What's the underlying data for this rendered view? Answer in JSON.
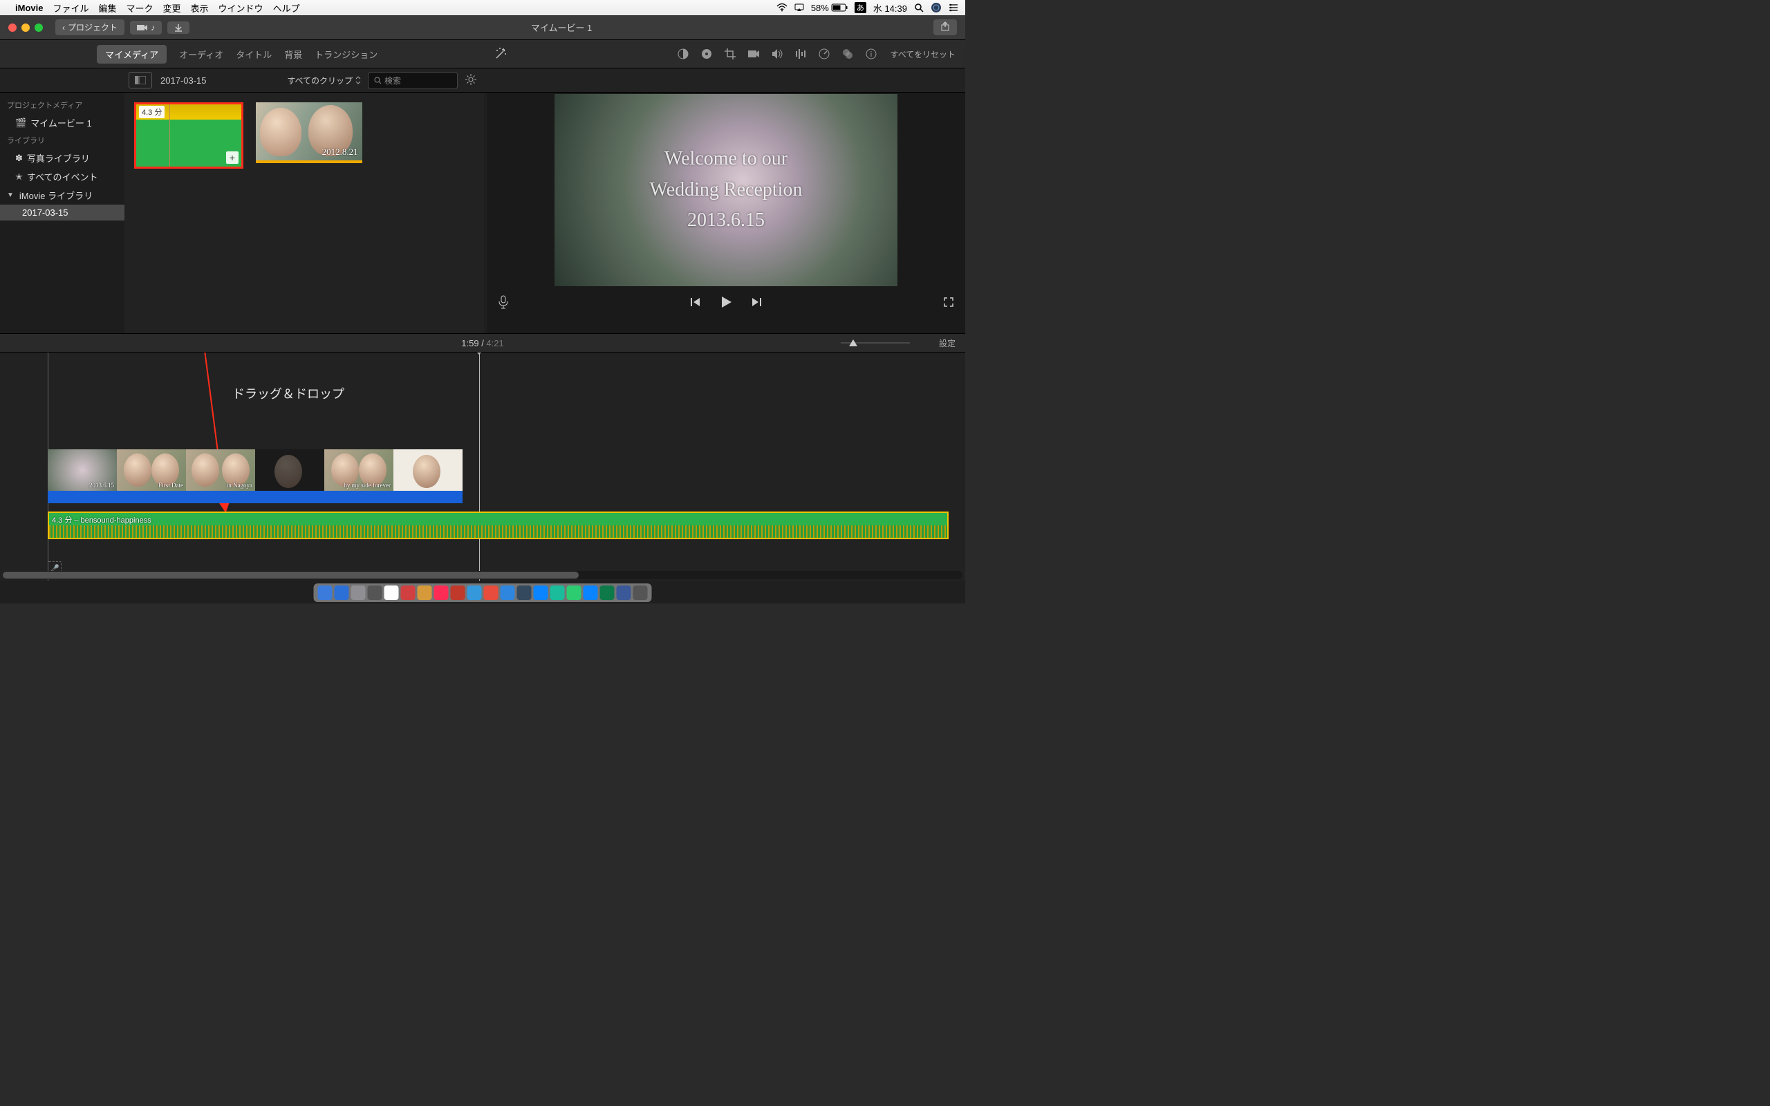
{
  "menubar": {
    "app": "iMovie",
    "items": [
      "ファイル",
      "編集",
      "マーク",
      "変更",
      "表示",
      "ウインドウ",
      "ヘルプ"
    ],
    "battery": "58%",
    "ime": "あ",
    "clock": "水 14:39"
  },
  "titlebar": {
    "back_label": "プロジェクト",
    "title": "マイムービー 1"
  },
  "tabs": {
    "items": [
      "マイメディア",
      "オーディオ",
      "タイトル",
      "背景",
      "トランジション"
    ],
    "active_index": 0,
    "reset_all": "すべてをリセット"
  },
  "browser_bar": {
    "event": "2017-03-15",
    "filter": "すべてのクリップ",
    "search_placeholder": "検索"
  },
  "sidebar": {
    "project_header": "プロジェクトメディア",
    "project_item": "マイムービー 1",
    "library_header": "ライブラリ",
    "photo_lib": "写真ライブラリ",
    "all_events": "すべてのイベント",
    "imovie_lib": "iMovie ライブラリ",
    "selected_event": "2017-03-15"
  },
  "clips": {
    "audio_duration": "4.3 分",
    "video_date": "2012.8.21"
  },
  "preview": {
    "line1": "Welcome to our",
    "line2": "Wedding Reception",
    "line3": "2013.6.15"
  },
  "timeline": {
    "current": "1:59",
    "total": "4:21",
    "settings": "設定",
    "annotation": "ドラッグ＆ドロップ",
    "audio_label": "4.3 分 – bensound-happiness",
    "video_captions": [
      "2013.6.15",
      "First Date",
      "in Nagoya",
      "",
      "",
      "by my side forever",
      ""
    ]
  },
  "dock_colors": [
    "#3b7bdc",
    "#2c6fd6",
    "#8e8e93",
    "#555",
    "#fff",
    "#d04040",
    "#d69a3a",
    "#ff2d55",
    "#c0392b",
    "#3498db",
    "#e74c3c",
    "#2e86de",
    "#34495e",
    "#0b84ff",
    "#1abc9c",
    "#2ecc71",
    "#0b84ff",
    "#0e7a4a",
    "#3b5998",
    "#555"
  ]
}
